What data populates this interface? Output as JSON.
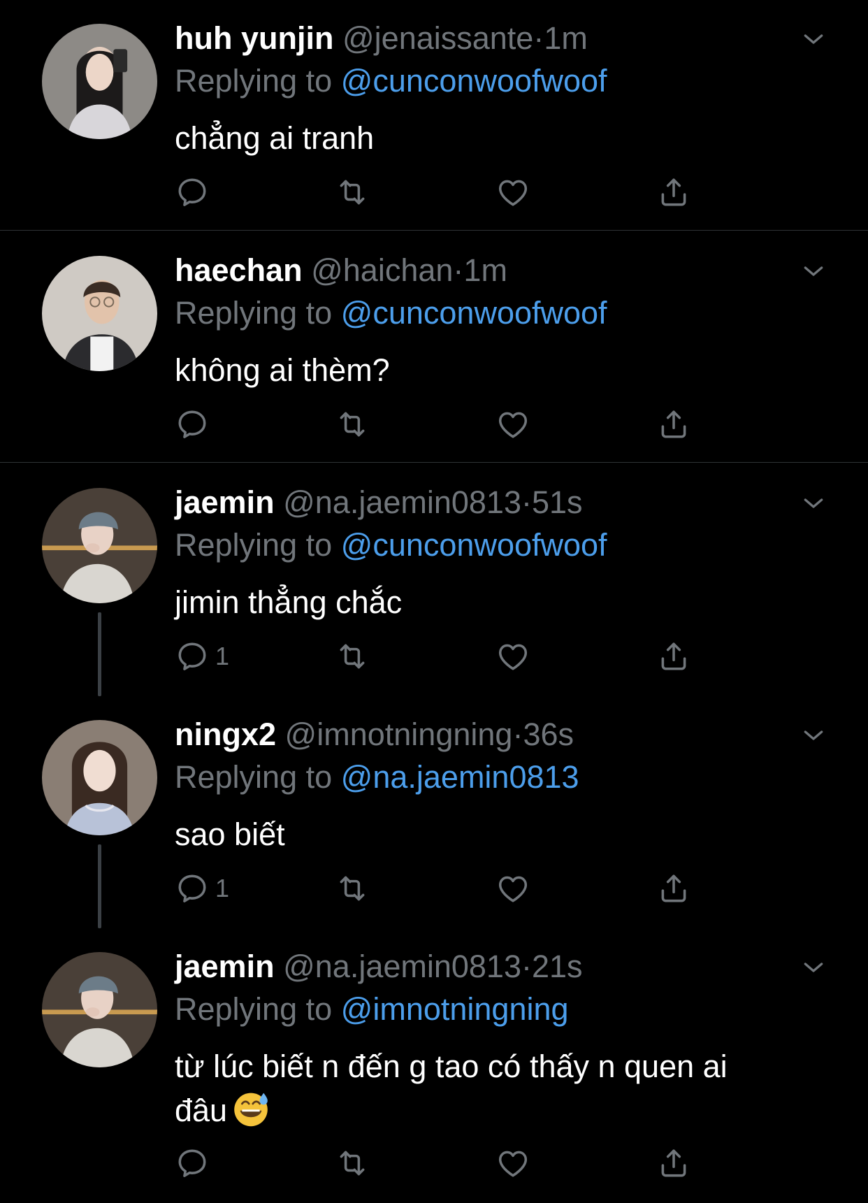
{
  "colors": {
    "background": "#000000",
    "name": "#ffffff",
    "muted": "#71767b",
    "link": "#4c9eeb",
    "divider": "#2f3336"
  },
  "tweets": [
    {
      "name": "huh yunjin",
      "handle": "@jenaissante",
      "dot": "·",
      "time": "1m",
      "reply_prefix": "Replying to",
      "reply_to": "@cunconwoofwoof",
      "text": "chẳng ai tranh",
      "reply_count": ""
    },
    {
      "name": "haechan",
      "handle": "@haichan",
      "dot": "·",
      "time": "1m",
      "reply_prefix": "Replying to",
      "reply_to": "@cunconwoofwoof",
      "text": "không ai thèm?",
      "reply_count": ""
    },
    {
      "name": "jaemin",
      "handle": "@na.jaemin0813",
      "dot": "·",
      "time": "51s",
      "reply_prefix": "Replying to",
      "reply_to": "@cunconwoofwoof",
      "text": "jimin thẳng chắc",
      "reply_count": "1"
    },
    {
      "name": "ningx2",
      "handle": "@imnotningning",
      "dot": "·",
      "time": "36s",
      "reply_prefix": "Replying to",
      "reply_to": "@na.jaemin0813",
      "text": "sao biết",
      "reply_count": "1"
    },
    {
      "name": "jaemin",
      "handle": "@na.jaemin0813",
      "dot": "·",
      "time": "21s",
      "reply_prefix": "Replying to",
      "reply_to": "@imnotningning",
      "text_line1": "từ lúc biết n đến g tao có thấy n quen ai",
      "text_line2": "đâu",
      "reply_count": ""
    }
  ],
  "icons": {
    "reply": "reply-icon",
    "retweet": "retweet-icon",
    "like": "heart-icon",
    "share": "share-icon",
    "more": "chevron-down-icon",
    "emoji": "grinning-sweat-emoji"
  }
}
